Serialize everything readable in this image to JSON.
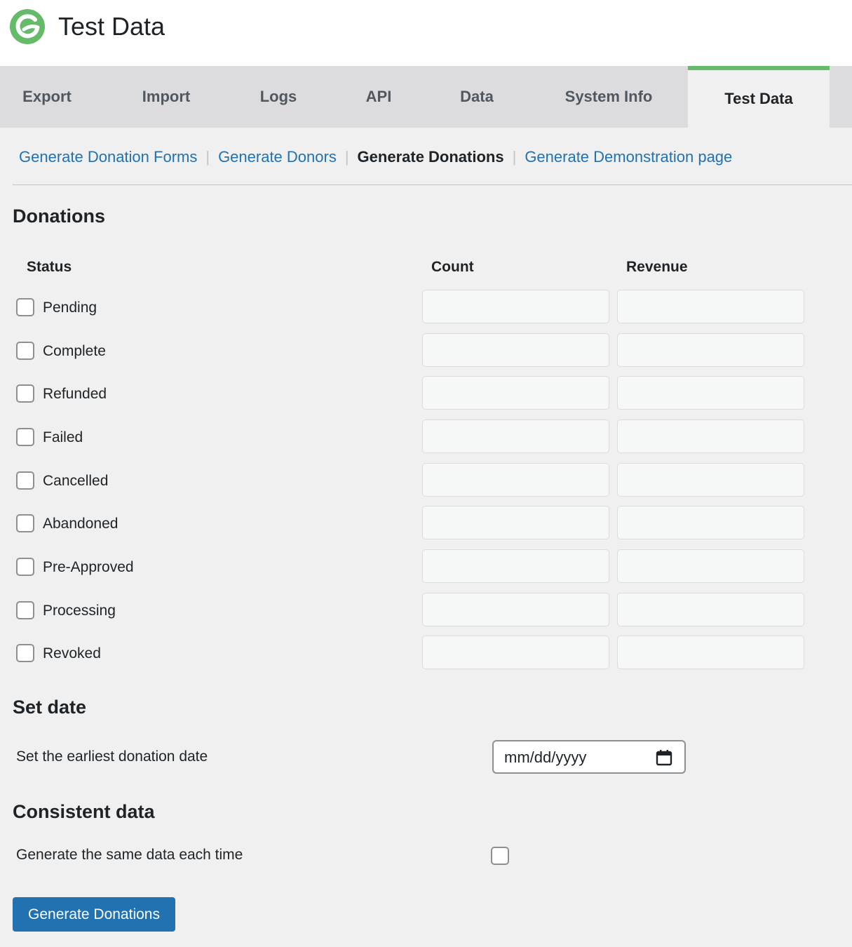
{
  "header": {
    "title": "Test Data"
  },
  "tabs": [
    {
      "label": "Export"
    },
    {
      "label": "Import"
    },
    {
      "label": "Logs"
    },
    {
      "label": "API"
    },
    {
      "label": "Data"
    },
    {
      "label": "System Info"
    },
    {
      "label": "Test Data"
    }
  ],
  "subnav": {
    "forms": "Generate Donation Forms",
    "donors": "Generate Donors",
    "donations": "Generate Donations",
    "demo": "Generate Demonstration page",
    "separator": "|"
  },
  "donations": {
    "heading": "Donations",
    "columns": {
      "status": "Status",
      "count": "Count",
      "revenue": "Revenue"
    },
    "statuses": [
      {
        "label": "Pending",
        "count": "",
        "revenue": ""
      },
      {
        "label": "Complete",
        "count": "",
        "revenue": ""
      },
      {
        "label": "Refunded",
        "count": "",
        "revenue": ""
      },
      {
        "label": "Failed",
        "count": "",
        "revenue": ""
      },
      {
        "label": "Cancelled",
        "count": "",
        "revenue": ""
      },
      {
        "label": "Abandoned",
        "count": "",
        "revenue": ""
      },
      {
        "label": "Pre-Approved",
        "count": "",
        "revenue": ""
      },
      {
        "label": "Processing",
        "count": "",
        "revenue": ""
      },
      {
        "label": "Revoked",
        "count": "",
        "revenue": ""
      }
    ]
  },
  "set_date": {
    "heading": "Set date",
    "label": "Set the earliest donation date",
    "placeholder": "mm/dd/yyyy",
    "icon": "calendar-icon"
  },
  "consistent": {
    "heading": "Consistent data",
    "label": "Generate the same data each time"
  },
  "submit_label": "Generate Donations",
  "colors": {
    "accent": "#2271b1",
    "brand_green": "#66bb6a",
    "background": "#f0f0f1"
  }
}
